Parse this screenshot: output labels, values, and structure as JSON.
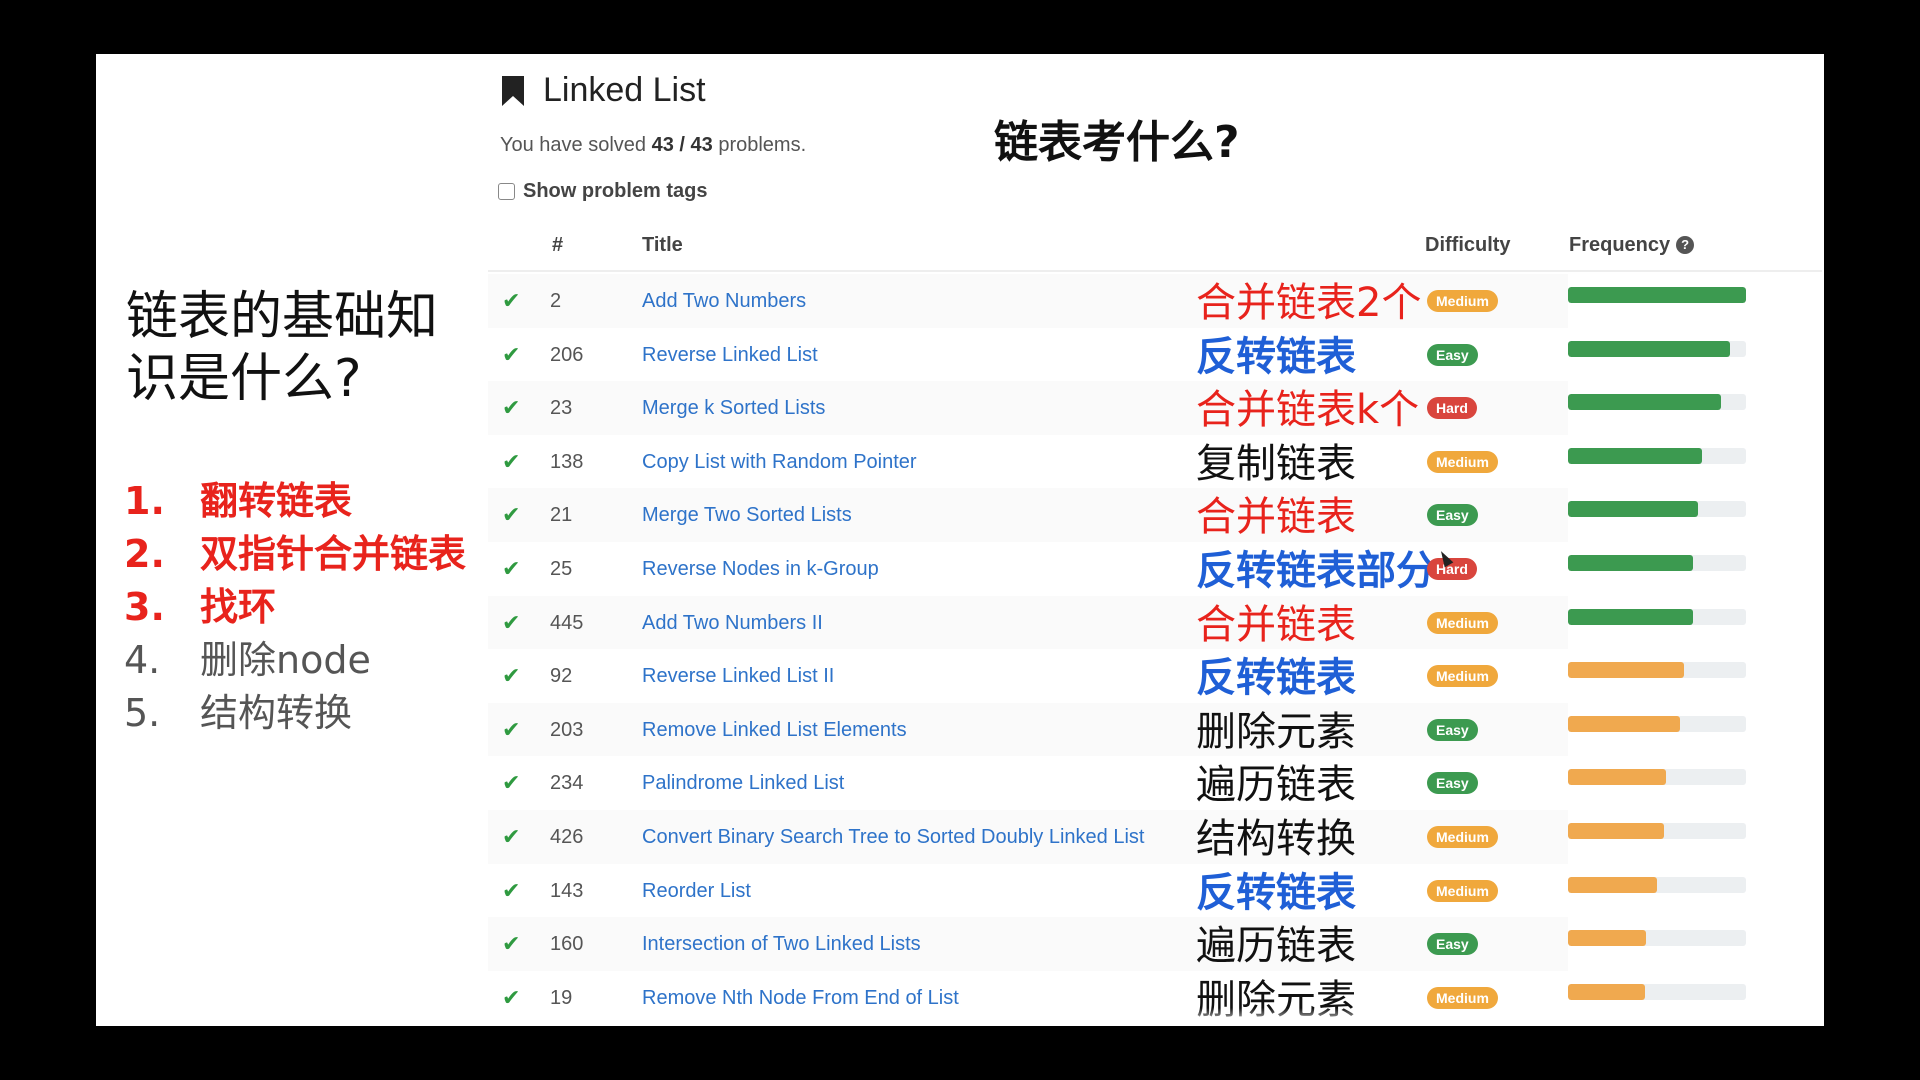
{
  "sidebar": {
    "title_line1": "链表的基础知",
    "title_line2": "识是什么?",
    "topics": [
      {
        "num": "1.",
        "label": "翻转链表",
        "highlight": true
      },
      {
        "num": "2.",
        "label": "双指针合并链表",
        "highlight": true
      },
      {
        "num": "3.",
        "label": "找环",
        "highlight": true
      },
      {
        "num": "4.",
        "label": "删除node",
        "highlight": false
      },
      {
        "num": "5.",
        "label": "结构转换",
        "highlight": false
      }
    ]
  },
  "header": {
    "icon": "bookmark-icon",
    "title": "Linked List",
    "solved_prefix": "You have solved ",
    "solved_count": "43 / 43",
    "solved_suffix": " problems.",
    "slide_heading": "链表考什么?",
    "show_tags_label": "Show problem tags",
    "show_tags_checked": false
  },
  "table": {
    "columns": {
      "num": "#",
      "title": "Title",
      "difficulty": "Difficulty",
      "frequency": "Frequency"
    },
    "rows": [
      {
        "id": "2",
        "title": "Add Two Numbers",
        "annotation": "合并链表2个",
        "anno_color": "red",
        "difficulty": "Medium",
        "frequency": 1.0
      },
      {
        "id": "206",
        "title": "Reverse Linked List",
        "annotation": "反转链表",
        "anno_color": "blue",
        "difficulty": "Easy",
        "frequency": 0.91
      },
      {
        "id": "23",
        "title": "Merge k Sorted Lists",
        "annotation": "合并链表k个",
        "anno_color": "red",
        "difficulty": "Hard",
        "frequency": 0.86
      },
      {
        "id": "138",
        "title": "Copy List with Random Pointer",
        "annotation": "复制链表",
        "anno_color": "black",
        "difficulty": "Medium",
        "frequency": 0.75
      },
      {
        "id": "21",
        "title": "Merge Two Sorted Lists",
        "annotation": "合并链表",
        "anno_color": "red",
        "difficulty": "Easy",
        "frequency": 0.73
      },
      {
        "id": "25",
        "title": "Reverse Nodes in k-Group",
        "annotation": "反转链表部分",
        "anno_color": "blue",
        "difficulty": "Hard",
        "frequency": 0.7
      },
      {
        "id": "445",
        "title": "Add Two Numbers II",
        "annotation": "合并链表",
        "anno_color": "red",
        "difficulty": "Medium",
        "frequency": 0.7
      },
      {
        "id": "92",
        "title": "Reverse Linked List II",
        "annotation": "反转链表",
        "anno_color": "blue",
        "difficulty": "Medium",
        "frequency": 0.65
      },
      {
        "id": "203",
        "title": "Remove Linked List Elements",
        "annotation": "删除元素",
        "anno_color": "black",
        "difficulty": "Easy",
        "frequency": 0.63
      },
      {
        "id": "234",
        "title": "Palindrome Linked List",
        "annotation": "遍历链表",
        "anno_color": "black",
        "difficulty": "Easy",
        "frequency": 0.55
      },
      {
        "id": "426",
        "title": "Convert Binary Search Tree to Sorted Doubly Linked List",
        "annotation": "结构转换",
        "anno_color": "black",
        "difficulty": "Medium",
        "frequency": 0.54
      },
      {
        "id": "143",
        "title": "Reorder List",
        "annotation": "反转链表",
        "anno_color": "blue",
        "difficulty": "Medium",
        "frequency": 0.5
      },
      {
        "id": "160",
        "title": "Intersection of Two Linked Lists",
        "annotation": "遍历链表",
        "anno_color": "black",
        "difficulty": "Easy",
        "frequency": 0.44
      },
      {
        "id": "19",
        "title": "Remove Nth Node From End of List",
        "annotation": "删除元素",
        "anno_color": "black",
        "difficulty": "Medium",
        "frequency": 0.43
      }
    ]
  },
  "colors": {
    "freq_high": "#3c9a50",
    "freq_low": "#f0a94f",
    "link": "#2e73c9",
    "check": "#2f9a40"
  }
}
